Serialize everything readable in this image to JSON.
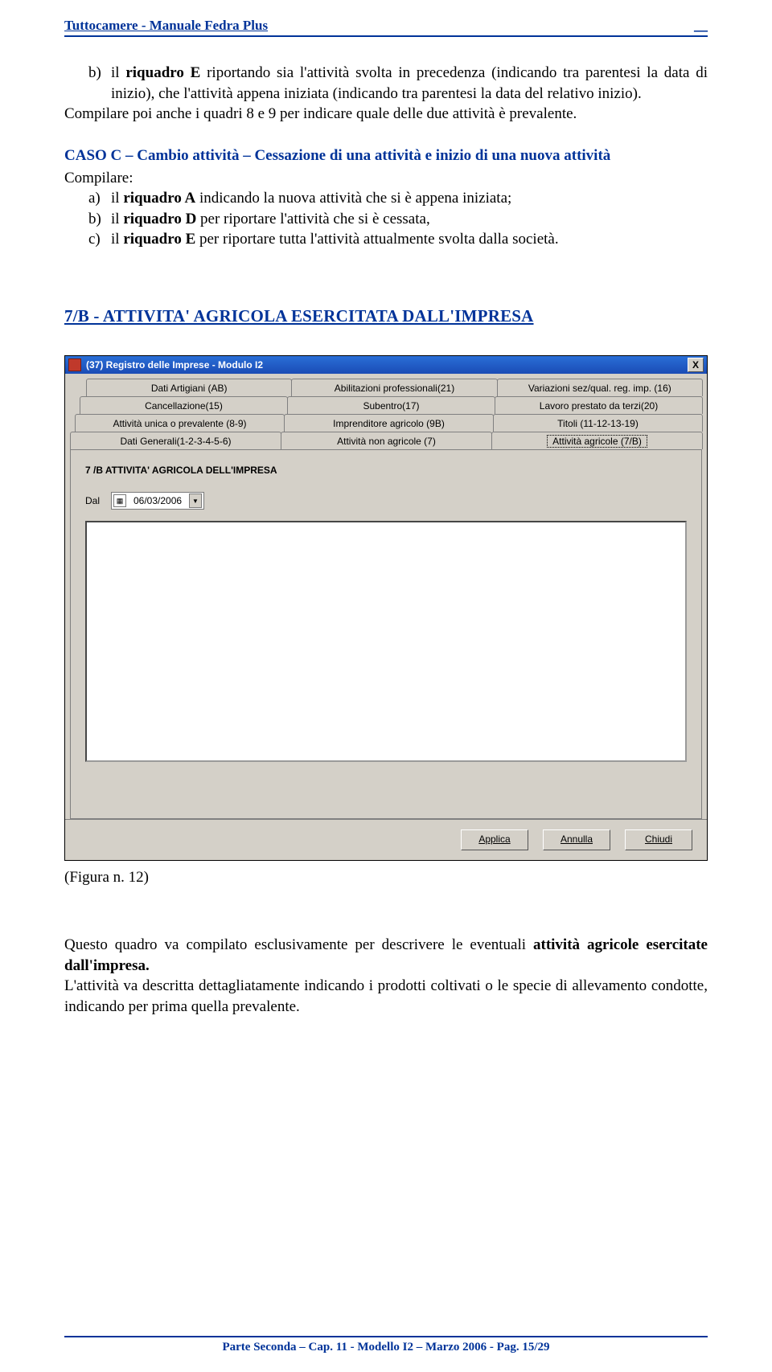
{
  "header": {
    "title": "Tuttocamere - Manuale Fedra Plus",
    "sep": "__"
  },
  "para_b": {
    "prefix": "b)",
    "html_parts": {
      "p1a": "il ",
      "p1b": "riquadro E",
      "p1c": " riportando sia l'attività svolta in precedenza (indicando tra parentesi la data di inizio), che l'attività appena iniziata (indicando tra parentesi la data del relativo inizio)."
    }
  },
  "para_compilare89": "Compilare poi anche i quadri 8 e 9 per indicare quale delle due attività è prevalente.",
  "caso_c_title": "CASO C – Cambio attività – Cessazione di una attività e inizio di una nuova attività",
  "compilare_label": "Compilare:",
  "list_abc": {
    "a": {
      "mk": "a)",
      "p1": "il ",
      "b": "riquadro A",
      "p2": " indicando la nuova attività che si è appena iniziata;"
    },
    "b": {
      "mk": "b)",
      "p1": "il ",
      "b": "riquadro D",
      "p2": " per riportare l'attività che si è cessata,"
    },
    "c": {
      "mk": "c)",
      "p1": "il ",
      "b": "riquadro E",
      "p2": " per riportare tutta l'attività attualmente svolta dalla società."
    }
  },
  "h7b": "7/B - ATTIVITA' AGRICOLA ESERCITATA DALL'IMPRESA",
  "win": {
    "title": "(37) Registro delle Imprese - Modulo I2",
    "close": "X",
    "tabs_r1": [
      "Dati Artigiani (AB)",
      "Abilitazioni professionali(21)",
      "Variazioni sez/qual. reg. imp. (16)"
    ],
    "tabs_r2": [
      "Cancellazione(15)",
      "Subentro(17)",
      "Lavoro prestato da terzi(20)"
    ],
    "tabs_r3": [
      "Attività unica o prevalente (8-9)",
      "Imprenditore agricolo (9B)",
      "Titoli (11-12-13-19)"
    ],
    "tabs_r4": [
      "Dati Generali(1-2-3-4-5-6)",
      "Attività non agricole (7)",
      "Attività agricole (7/B)"
    ],
    "panel_title": "7 /B ATTIVITA' AGRICOLA DELL'IMPRESA",
    "dal_label": "Dal",
    "date_value": "06/03/2006",
    "buttons": {
      "applica": "Applica",
      "annulla": "Annulla",
      "chiudi": "Chiudi"
    }
  },
  "fig_caption": "(Figura n. 12)",
  "outro": {
    "p1a": "Questo quadro va compilato esclusivamente per descrivere le eventuali ",
    "p1b": "attività agricole esercitate dall'impresa.",
    "p2": "L'attività va descritta dettagliatamente indicando i prodotti coltivati o le specie di allevamento condotte, indicando per prima quella prevalente."
  },
  "footer": "Parte Seconda – Cap. 11 - Modello I2 – Marzo 2006 - Pag. 15/29"
}
